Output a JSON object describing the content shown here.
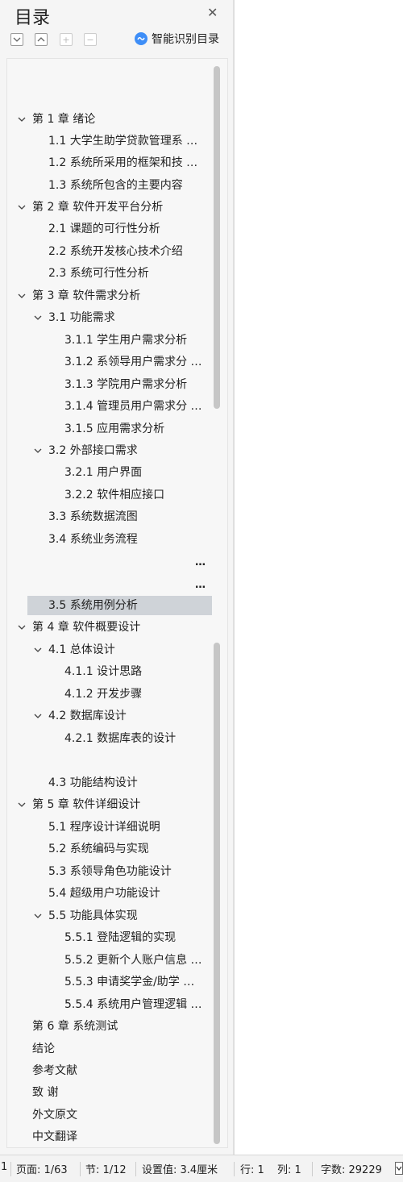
{
  "panel": {
    "title": "目录",
    "ai_button_label": "智能识别目录",
    "accent_color": "#3e8ef7"
  },
  "toolbar": {
    "expand_icon": "chevron-down-box-icon",
    "collapse_icon": "chevron-up-box-icon",
    "add_icon": "plus-box-icon",
    "remove_icon": "minus-box-icon",
    "add_glyph": "+",
    "remove_glyph": "−"
  },
  "toc": [
    {
      "label": "第 1 章  绪论",
      "level": 0,
      "expanded": true
    },
    {
      "label": "1.1 大学生助学贷款管理系 …",
      "level": 1
    },
    {
      "label": "1.2 系统所采用的框架和技 …",
      "level": 1
    },
    {
      "label": "1.3 系统所包含的主要内容",
      "level": 1
    },
    {
      "label": "第 2 章    软件开发平台分析",
      "level": 0,
      "expanded": true
    },
    {
      "label": "2.1  课题的可行性分析",
      "level": 1
    },
    {
      "label": "2.2  系统开发核心技术介绍",
      "level": 1
    },
    {
      "label": "2.3  系统可行性分析",
      "level": 1
    },
    {
      "label": "第 3 章    软件需求分析",
      "level": 0,
      "expanded": true
    },
    {
      "label": "3.1 功能需求",
      "level": 1,
      "expanded": true
    },
    {
      "label": "3.1.1 学生用户需求分析",
      "level": 2
    },
    {
      "label": "3.1.2 系领导用户需求分 …",
      "level": 2
    },
    {
      "label": "3.1.3 学院用户需求分析",
      "level": 2
    },
    {
      "label": "3.1.4 管理员用户需求分 …",
      "level": 2
    },
    {
      "label": "3.1.5 应用需求分析",
      "level": 2
    },
    {
      "label": "3.2 外部接口需求",
      "level": 1,
      "expanded": true
    },
    {
      "label": "3.2.1 用户界面",
      "level": 2
    },
    {
      "label": "3.2.2 软件相应接口",
      "level": 2
    },
    {
      "label": "3.3 系统数据流图",
      "level": 1
    },
    {
      "label": "3.4 系统业务流程",
      "level": 1
    },
    {
      "label": "3.5 系统用例分析",
      "level": 1,
      "selected": true
    },
    {
      "label": "第 4 章    软件概要设计",
      "level": 0,
      "expanded": true
    },
    {
      "label": "4.1 总体设计",
      "level": 1,
      "expanded": true
    },
    {
      "label": "4.1.1 设计思路",
      "level": 2
    },
    {
      "label": "4.1.2 开发步骤",
      "level": 2
    },
    {
      "label": "4.2 数据库设计",
      "level": 1,
      "expanded": true
    },
    {
      "label": "4.2.1 数据库表的设计",
      "level": 2
    },
    {
      "label": "4.3 功能结构设计",
      "level": 1
    },
    {
      "label": "第 5 章    软件详细设计",
      "level": 0,
      "expanded": true
    },
    {
      "label": "5.1 程序设计详细说明",
      "level": 1
    },
    {
      "label": "5.2  系统编码与实现",
      "level": 1
    },
    {
      "label": "5.3  系领导角色功能设计",
      "level": 1
    },
    {
      "label": "5.4  超级用户功能设计",
      "level": 1
    },
    {
      "label": "5.5  功能具体实现",
      "level": 1,
      "expanded": true
    },
    {
      "label": "5.5.1  登陆逻辑的实现",
      "level": 2
    },
    {
      "label": "5.5.2  更新个人账户信息 …",
      "level": 2
    },
    {
      "label": "5.5.3  申请奖学金/助学 …",
      "level": 2
    },
    {
      "label": "5.5.4 系统用户管理逻辑 …",
      "level": 2
    },
    {
      "label": "第 6 章    系统测试",
      "level": 0
    },
    {
      "label": "结论",
      "level": 0
    },
    {
      "label": "参考文献",
      "level": 0
    },
    {
      "label": "致  谢",
      "level": 0
    },
    {
      "label": "外文原文",
      "level": 0
    },
    {
      "label": "中文翻译",
      "level": 0
    }
  ],
  "tree_ellipsis": [
    "…",
    "…"
  ],
  "status": {
    "section_prefix": "1",
    "page": "页面: 1/63",
    "section": "节: 1/12",
    "setting": "设置值: 3.4厘米",
    "row": "行: 1",
    "col": "列: 1",
    "word_count": "字数: 29229"
  }
}
